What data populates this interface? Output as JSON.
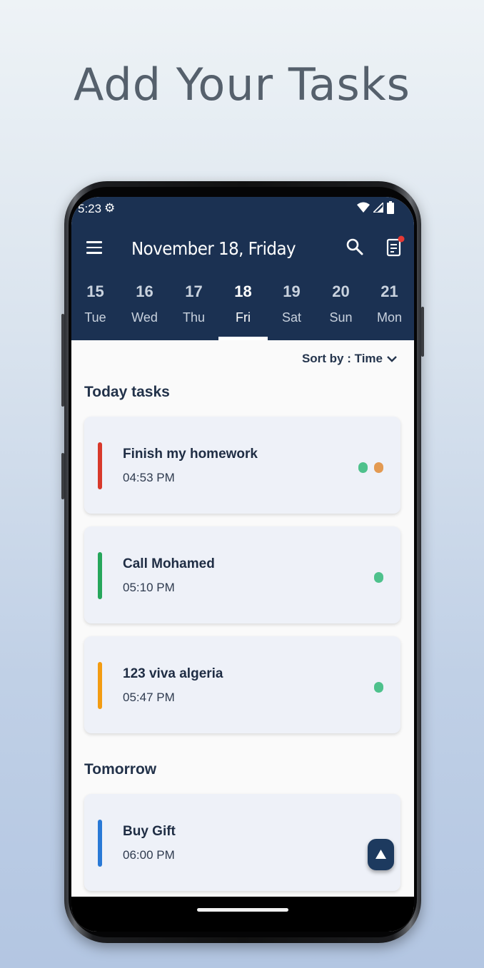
{
  "headline": "Add Your Tasks",
  "status_bar": {
    "time": "5:23",
    "icons": [
      "gear-icon",
      "wifi-icon",
      "signal-icon",
      "battery-icon"
    ]
  },
  "app_bar": {
    "title": "November 18, Friday",
    "icons": [
      "menu-icon",
      "search-icon",
      "notes-icon"
    ],
    "notification_dot_color": "#e53935"
  },
  "date_strip": [
    {
      "num": "15",
      "dow": "Tue"
    },
    {
      "num": "16",
      "dow": "Wed"
    },
    {
      "num": "17",
      "dow": "Thu"
    },
    {
      "num": "18",
      "dow": "Fri",
      "selected": true
    },
    {
      "num": "19",
      "dow": "Sat"
    },
    {
      "num": "20",
      "dow": "Sun"
    },
    {
      "num": "21",
      "dow": "Mon"
    }
  ],
  "sort": {
    "label": "Sort by : Time"
  },
  "sections": {
    "today": {
      "title": "Today tasks",
      "tasks": [
        {
          "name": "Finish my homework",
          "time": "04:53 PM",
          "bar_color": "#d8392b",
          "dots": [
            "#4ec18c",
            "#e39a52"
          ]
        },
        {
          "name": "Call Mohamed",
          "time": "05:10 PM",
          "bar_color": "#26a65b",
          "dots": [
            "#4ec18c"
          ]
        },
        {
          "name": "123 viva algeria",
          "time": "05:47 PM",
          "bar_color": "#f39c12",
          "dots": [
            "#4ec18c"
          ]
        }
      ]
    },
    "tomorrow": {
      "title": "Tomorrow",
      "tasks": [
        {
          "name": "Buy Gift",
          "time": "06:00 PM",
          "bar_color": "#2979d6",
          "dots": []
        }
      ]
    }
  },
  "colors": {
    "header": "#1b3152",
    "card": "#eef1f8",
    "fab": "#1d3a5f"
  }
}
